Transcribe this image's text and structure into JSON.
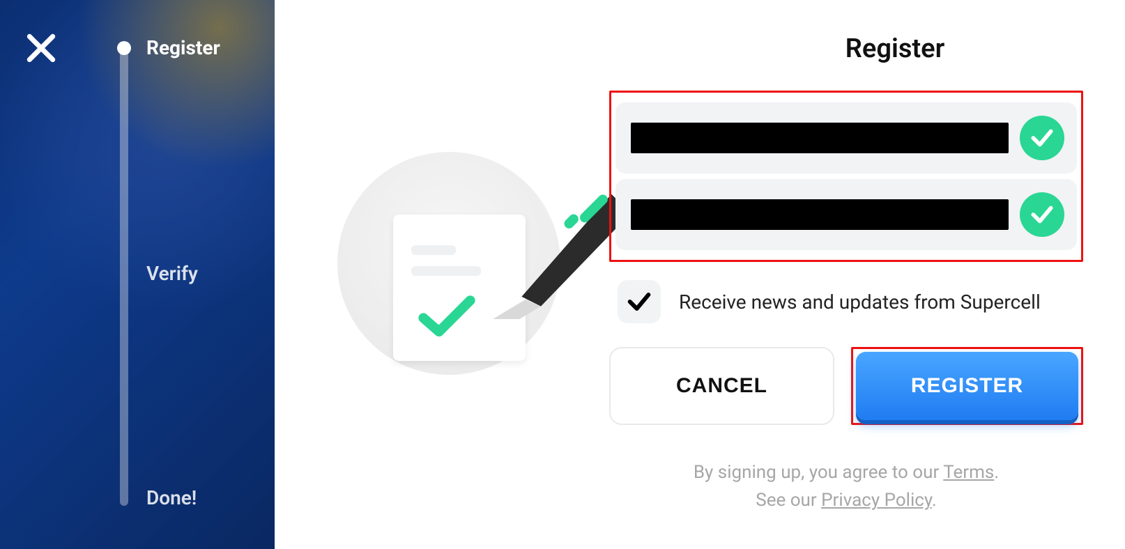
{
  "sidebar": {
    "steps": [
      {
        "id": "register",
        "label": "Register",
        "active": true
      },
      {
        "id": "verify",
        "label": "Verify",
        "active": false
      },
      {
        "id": "done",
        "label": "Done!",
        "active": false
      }
    ]
  },
  "main": {
    "title": "Register",
    "fields": [
      {
        "id": "email",
        "redacted": true,
        "valid": true
      },
      {
        "id": "email_confirm",
        "redacted": true,
        "valid": true
      }
    ],
    "newsletter": {
      "checked": true,
      "label": "Receive news and updates from Supercell"
    },
    "buttons": {
      "cancel": "CANCEL",
      "register": "REGISTER"
    },
    "legal": {
      "line1_pre": "By signing up, you agree to our ",
      "terms": "Terms",
      "line1_post": ".",
      "line2_pre": "See our ",
      "privacy": "Privacy Policy",
      "line2_post": "."
    }
  },
  "colors": {
    "accent_green": "#2ad694",
    "accent_blue": "#1f7cf2",
    "highlight_red": "#e11"
  }
}
